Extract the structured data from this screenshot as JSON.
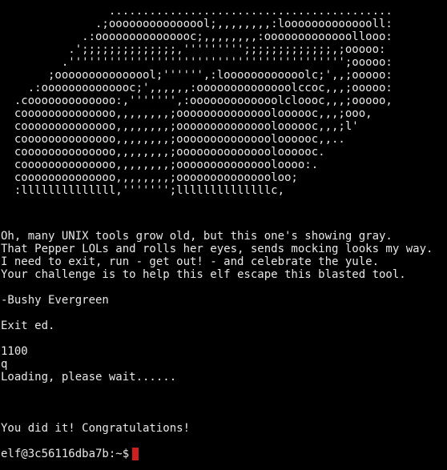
{
  "terminal": {
    "art_lines": [
      "                ..........................................",
      "              .;ooooooooooooool;,,,,,,,,:loooooooooooooll:",
      "            .:ooooooooooooooc;,,,,,,,,:ooooooooooooollooo:",
      "          .';;;;;;;;;;;;;;,''''''''';;;;;;;;;;;;;,;ooooo:",
      "         .''''''''''''''''''''''''''''''''''''''''';ooooo:",
      "       ;ooooooooooooool;'''''',:loooooooooooolc;',,;ooooo:",
      "    .:oooooooooooooc;',,,,,,:oooooooooooooolccoc,,,;ooooo:",
      "  .cooooooooooooo:,''''''',:ooooooooooooolcloooc,,,;ooooo,",
      "  coooooooooooooo,,,,,,,,;ooooooooooooooloooooc,,,;ooo,",
      "  coooooooooooooo,,,,,,,,;ooooooooooooooloooooc,,,;l'",
      "  coooooooooooooo,,,,,,,,;ooooooooooooooloooooc,,..",
      "  coooooooooooooo,,,,,,,,;ooooooooooooooloooooc.",
      "  coooooooooooooo,,,,,,,,;ooooooooooooooloooo:.",
      "  coooooooooooooo,,,,,,,,;ooooooooooooooloo;",
      "  :llllllllllllll,''''''';llllllllllllllc,"
    ],
    "poem_lines": [
      "Oh, many UNIX tools grow old, but this one's showing gray.",
      "That Pepper LOLs and rolls her eyes, sends mocking looks my way.",
      "I need to exit, run - get out! - and celebrate the yule.",
      "Your challenge is to help this elf escape this blasted tool."
    ],
    "signature": "-Bushy Evergreen",
    "task": "Exit ed.",
    "input_number": "1100",
    "input_quit": "q",
    "loading": "Loading, please wait......",
    "success": "You did it! Congratulations!",
    "prompt": "elf@3c56116dba7b:~$",
    "cursor_color": "#cc1f1f"
  }
}
